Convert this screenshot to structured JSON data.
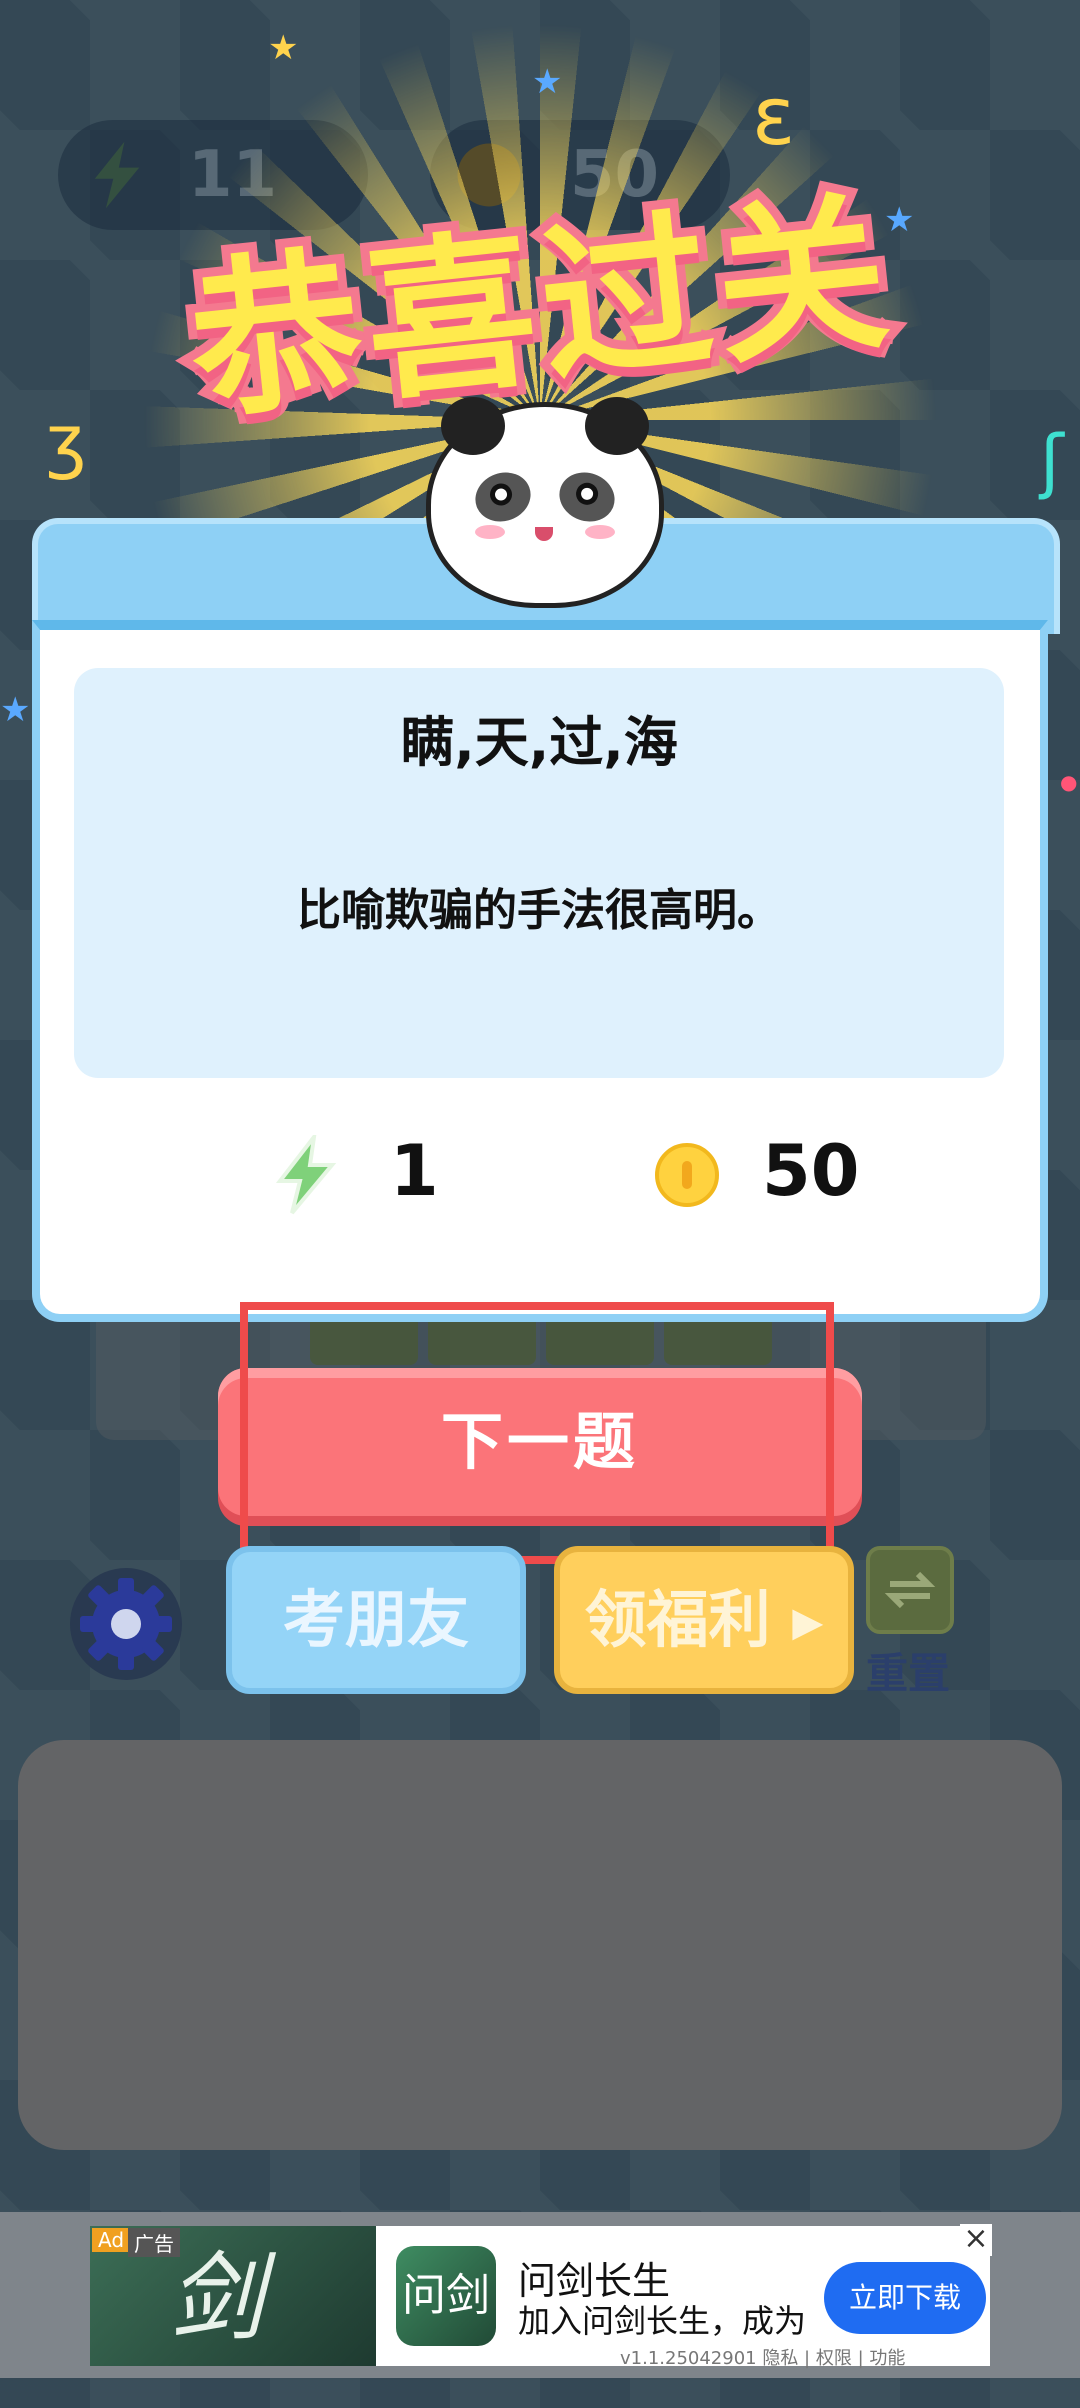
{
  "hud": {
    "energy": "11",
    "coins": "50"
  },
  "popup": {
    "title": "恭喜过关",
    "idiom": "瞒,天,过,海",
    "meaning": "比喻欺骗的手法很高明。",
    "reward_energy": "1",
    "reward_coins": "50",
    "next_label": "下一题"
  },
  "bottom": {
    "friend_label": "考朋友",
    "welfare_label": "领福利 ▸",
    "reset_label": "重置"
  },
  "ad": {
    "badge": "Ad",
    "badge2": "广告",
    "app_name": "问剑长生",
    "description": "加入问剑长生，成为",
    "download_label": "立即下载",
    "meta": "v1.1.25042901 隐私 | 权限 | 功能",
    "close": "×"
  },
  "colors": {
    "title": "#ffea4d",
    "title_stroke": "#f4798f",
    "next_button": "#fb7479",
    "friend_button": "#94d4f7",
    "welfare_button": "#ffcf5c",
    "highlight": "#ef4b4b"
  }
}
